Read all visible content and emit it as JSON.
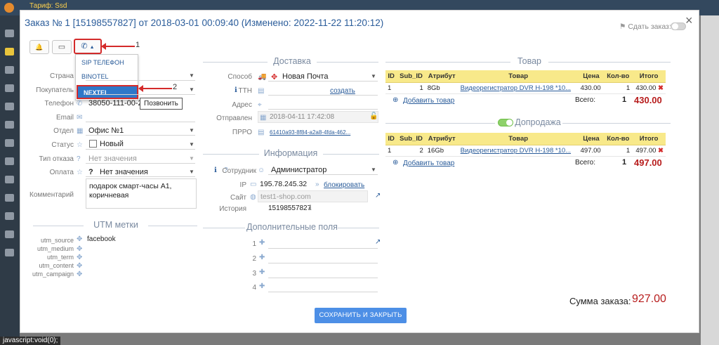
{
  "topbar": {
    "text": "Тариф: Ssd"
  },
  "statusbar": {
    "text": "javascript:void(0);"
  },
  "modal": {
    "title": "Заказ № 1 [15198557827] от 2018-03-01 00:09:40 (Изменено: 2022-11-22 11:20:12)",
    "close": "×",
    "gift_label": "Сдать заказ:"
  },
  "toolbar": {
    "bell": "🔔",
    "screen": "▭",
    "phone": "✆"
  },
  "dropdown": {
    "items": [
      "SIP ТЕЛЕФОН",
      "BINOTEL",
      "NEXTEL"
    ]
  },
  "annotations": {
    "one": "1",
    "two": "2"
  },
  "tooltip": "Позвонить",
  "customer": {
    "labels": {
      "country": "Страна",
      "buyer": "Покупатель",
      "phone": "Телефон",
      "email": "Email",
      "dept": "Отдел",
      "status": "Статус",
      "refusal": "Тип отказа",
      "payment": "Оплата",
      "comment": "Комментарий"
    },
    "phone": "38050-111-00-22",
    "dept": "Офис №1",
    "status": "Новый",
    "refusal": "Нет значения",
    "payment": "Нет значения",
    "comment": "подарок смарт-часы А1, коричневая"
  },
  "utm": {
    "title": "UTM метки",
    "labels": [
      "utm_source",
      "utm_medium",
      "utm_term",
      "utm_content",
      "utm_campaign"
    ],
    "source_value": "facebook"
  },
  "delivery": {
    "title": "Доставка",
    "labels": {
      "method": "Способ",
      "ttn": "ТТН",
      "address": "Адрес",
      "sent": "Отправлен",
      "prro": "ПРРО"
    },
    "method": "Новая Почта",
    "create": "создать",
    "sent_value": "2018-04-11 17:42:08",
    "prro_value": "61410a93-8f84-a2a8-4fda-462..."
  },
  "info": {
    "title": "Информация",
    "labels": {
      "employee": "Сотрудник",
      "ip": "IP",
      "site": "Сайт",
      "history": "История"
    },
    "employee": "Администратор",
    "ip": "195.78.245.32",
    "block": "блокировать",
    "site": "test1-shop.com",
    "history": "15198557827"
  },
  "extra": {
    "title": "Дополнительные поля",
    "rows": [
      "1",
      "2",
      "3",
      "4"
    ]
  },
  "goods": {
    "title": "Товар",
    "headers": [
      "ID",
      "Sub_ID",
      "Атрибут",
      "Товар",
      "Цена",
      "Кол-во",
      "Итого"
    ],
    "row": {
      "id": "1",
      "sub": "1",
      "attr": "8Gb",
      "name": "Видеорегистратор DVR H-198 *10...",
      "price": "430.00",
      "qty": "1",
      "total": "430.00"
    },
    "add": "Добавить товар",
    "total_label": "Всего:",
    "total_qty": "1",
    "total_sum": "430.00"
  },
  "upsell": {
    "title": "Допродажа",
    "headers": [
      "ID",
      "Sub_ID",
      "Атрибут",
      "Товар",
      "Цена",
      "Кол-во",
      "Итого"
    ],
    "row": {
      "id": "1",
      "sub": "2",
      "attr": "16Gb",
      "name": "Видеорегистратор DVR H-198 *10...",
      "price": "497.00",
      "qty": "1",
      "total": "497.00"
    },
    "add": "Добавить товар",
    "total_label": "Всего:",
    "total_qty": "1",
    "total_sum": "497.00"
  },
  "summary": {
    "label": "Сумма заказа:",
    "value": "927.00"
  },
  "save_button": "СОХРАНИТЬ И ЗАКРЫТЬ",
  "colors": {
    "accent": "#2a5c9a",
    "highlight": "#d42b2b",
    "button": "#4d8fe6",
    "table_header": "#f8e98a"
  }
}
